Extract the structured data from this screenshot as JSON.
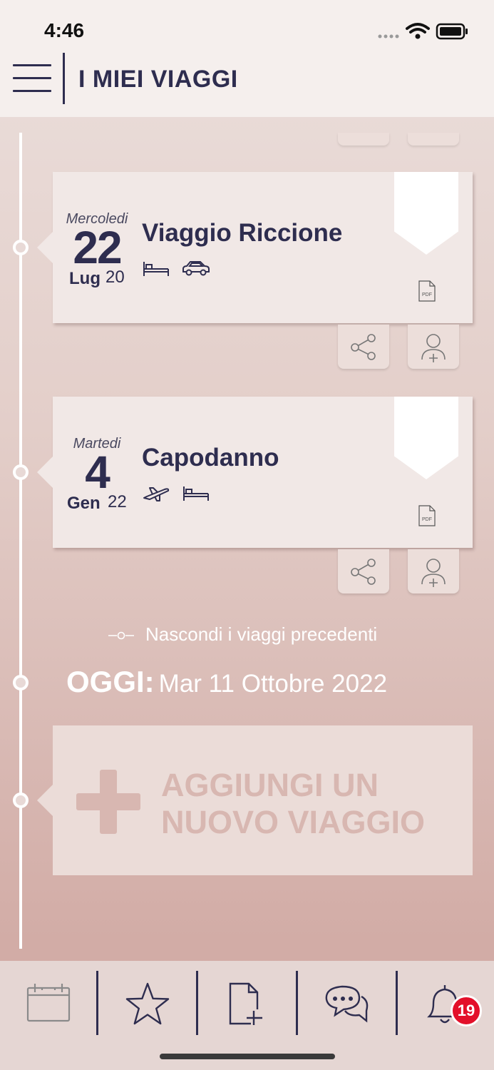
{
  "status": {
    "time": "4:46"
  },
  "header": {
    "title": "I MIEI VIAGGI"
  },
  "trips": [
    {
      "weekday": "Mercoledi",
      "day": "22",
      "month": "Lug",
      "year": "20",
      "title": "Viaggio Riccione",
      "services": [
        "bed-icon",
        "car-icon"
      ],
      "pdf_label": "PDF"
    },
    {
      "weekday": "Martedi",
      "day": "4",
      "month": "Gen",
      "year": "22",
      "title": "Capodanno",
      "services": [
        "plane-icon",
        "bed-icon"
      ],
      "pdf_label": "PDF"
    }
  ],
  "hide_previous": "Nascondi i viaggi precedenti",
  "today": {
    "label": "OGGI:",
    "date": "Mar 11 Ottobre 2022"
  },
  "add_trip": {
    "line1": "AGGIUNGI UN",
    "line2": "NUOVO VIAGGIO"
  },
  "tabbar": {
    "items": [
      "calendar-icon",
      "star-icon",
      "add-document-icon",
      "chat-icon",
      "bell-icon"
    ],
    "notification_count": "19"
  },
  "colors": {
    "primary": "#2e2d4f",
    "badge": "#e3102a",
    "accent_pale": "#d8b7b1"
  }
}
